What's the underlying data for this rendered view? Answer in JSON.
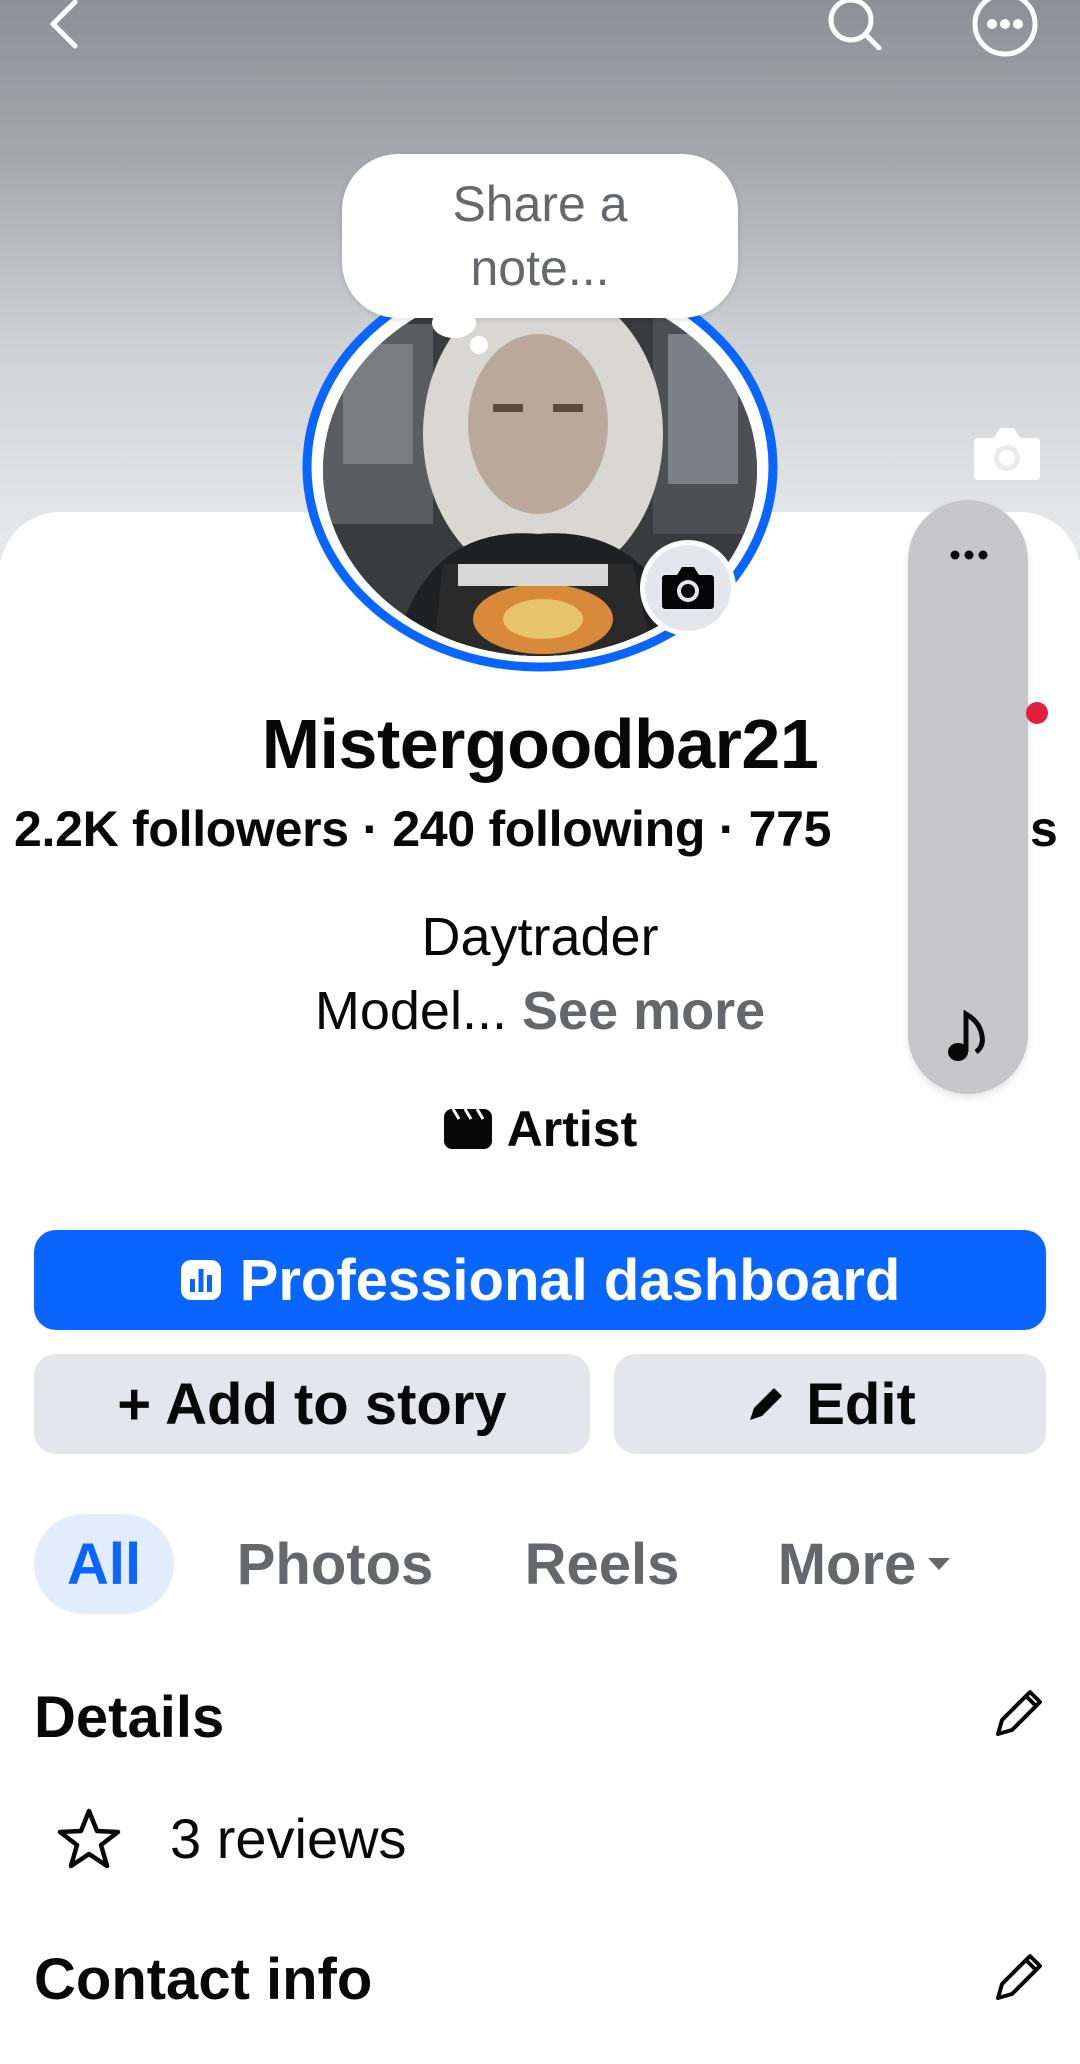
{
  "profile": {
    "name": "Mistergoodbar21",
    "stats": "2.2K followers · 240 following · 775",
    "stats_suffix": "s",
    "bio_line1": "Daytrader",
    "bio_line2": "Model...",
    "see_more": "See more",
    "category": "Artist"
  },
  "note": {
    "placeholder": "Share a note..."
  },
  "actions": {
    "dashboard_label": "Professional dashboard",
    "add_story_label": "+ Add to story",
    "edit_label": "Edit"
  },
  "tabs": [
    {
      "label": "All",
      "selected": true
    },
    {
      "label": "Photos",
      "selected": false
    },
    {
      "label": "Reels",
      "selected": false
    },
    {
      "label": "More",
      "selected": false
    }
  ],
  "details": {
    "title": "Details",
    "reviews": "3 reviews"
  },
  "contact": {
    "title": "Contact info"
  },
  "icons": {
    "back": "back-arrow-icon",
    "search": "search-icon",
    "more": "more-options-icon",
    "camera": "camera-icon",
    "music": "music-note-icon",
    "star": "star-icon",
    "pencil": "pencil-icon",
    "dashboard": "bar-chart-icon",
    "category": "clapperboard-icon"
  },
  "colors": {
    "primary": "#0866ff",
    "secondary_button": "#e4e6eb",
    "muted_text": "#65676b",
    "notification": "#e41e3f"
  }
}
